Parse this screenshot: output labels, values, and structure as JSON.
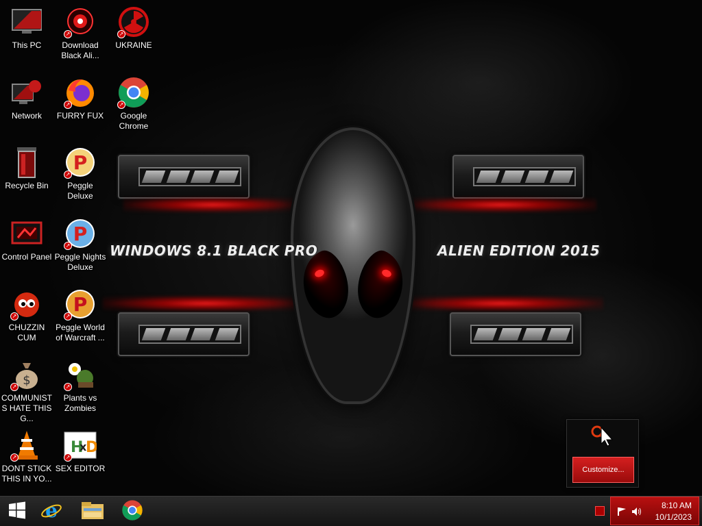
{
  "wallpaper": {
    "left_text": "WINDOWS 8.1 BLACK PRO",
    "right_text": "ALIEN EDITION 2015"
  },
  "desktop": {
    "icons": [
      {
        "label": "This PC",
        "icon": "this-pc-icon"
      },
      {
        "label": "Download Black Ali...",
        "icon": "alien-download-icon"
      },
      {
        "label": "UKRAINE",
        "icon": "radiation-icon"
      },
      {
        "label": "Network",
        "icon": "network-icon"
      },
      {
        "label": "FURRY FUX",
        "icon": "firefox-icon"
      },
      {
        "label": "Google Chrome",
        "icon": "chrome-icon"
      },
      {
        "label": "Recycle Bin",
        "icon": "recycle-bin-icon"
      },
      {
        "label": "Peggle Deluxe",
        "icon": "peggle-icon"
      },
      {
        "label": "Control Panel",
        "icon": "control-panel-icon"
      },
      {
        "label": "Peggle Nights Deluxe",
        "icon": "peggle-icon"
      },
      {
        "label": "CHUZZIN CUM",
        "icon": "chuzzle-icon"
      },
      {
        "label": "Peggle World of Warcraft ...",
        "icon": "peggle-icon"
      },
      {
        "label": "COMMUNISTS HATE THIS G...",
        "icon": "money-bag-icon"
      },
      {
        "label": "Plants vs Zombies",
        "icon": "plants-vs-zombies-icon"
      },
      {
        "label": "DONT STICK THIS IN YO...",
        "icon": "vlc-cone-icon"
      },
      {
        "label": "SEX EDITOR",
        "icon": "hex-editor-icon"
      }
    ]
  },
  "popup": {
    "button_label": "Customize..."
  },
  "taskbar": {
    "pinned": [
      "windows-start-icon",
      "internet-explorer-icon",
      "file-explorer-icon",
      "chrome-icon"
    ],
    "time": "8:10 AM",
    "date": "10/1/2023",
    "accent_color": "#b81010"
  }
}
